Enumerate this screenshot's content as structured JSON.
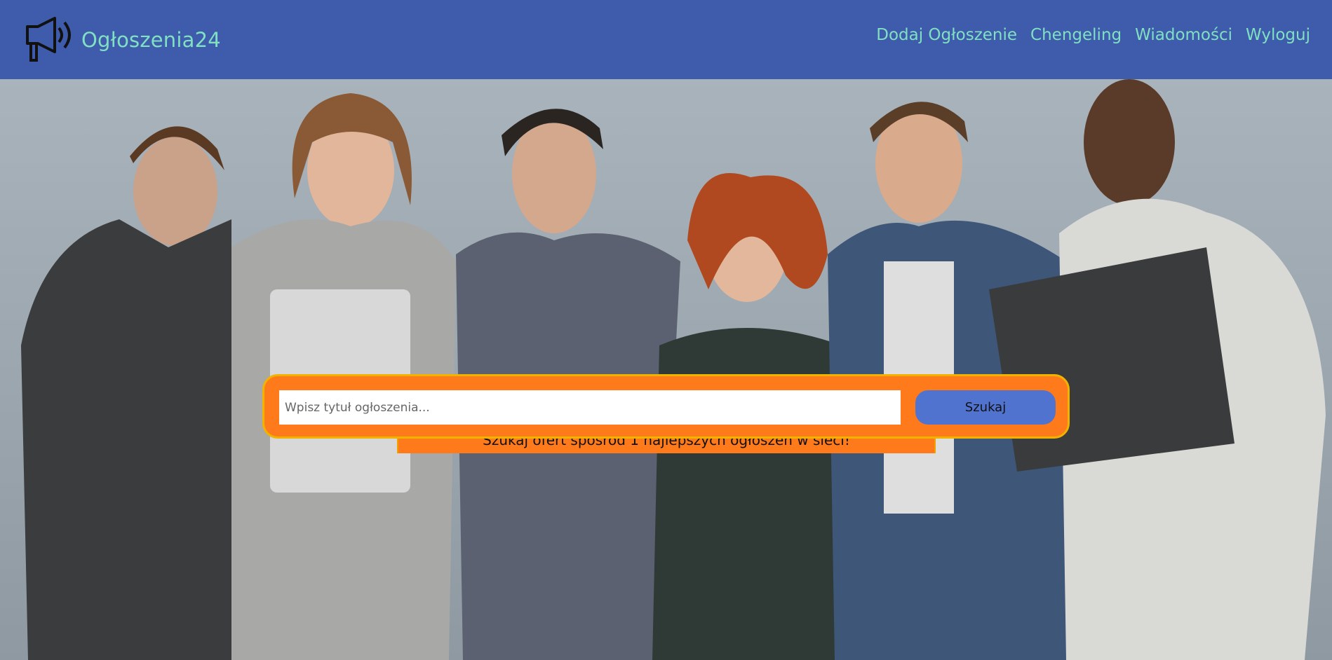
{
  "header": {
    "brand": "Ogłoszenia24",
    "logo_icon": "megaphone-icon",
    "nav": [
      {
        "label": "Dodaj Ogłoszenie"
      },
      {
        "label": "Chengeling"
      },
      {
        "label": "Wiadomości"
      },
      {
        "label": "Wyloguj"
      }
    ]
  },
  "hero": {
    "title": "Szukaj ofert sposród 1 najlepszych ogłoszeń w sieci!",
    "search_placeholder": "Wpisz tytuł ogłoszenia...",
    "search_button": "Szukaj"
  },
  "colors": {
    "header_bg": "#3f5bab",
    "brand_text": "#7fe0c2",
    "search_panel": "#ff7a1a",
    "search_button": "#5173d0"
  }
}
